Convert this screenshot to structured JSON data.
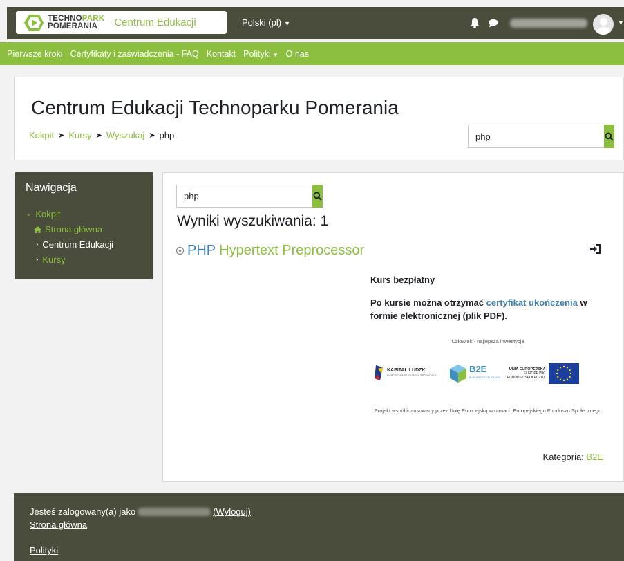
{
  "topbar": {
    "logo_line1": "TECHNO",
    "logo_line1_accent": "PARK",
    "logo_line2": "POMERANIA",
    "brand_name": "Centrum Edukacji",
    "language": "Polski (pl)",
    "icons": {
      "notifications": "bell-icon",
      "messages": "chat-icon",
      "avatar": "user-avatar-icon"
    }
  },
  "menu": {
    "items": [
      "Pierwsze kroki",
      "Certyfikaty i zaświadczenia - FAQ",
      "Kontakt",
      "Polityki",
      "O nas"
    ]
  },
  "header": {
    "title": "Centrum Edukacji Technoparku Pomerania",
    "breadcrumb": [
      "Kokpit",
      "Kursy",
      "Wyszukaj",
      "php"
    ],
    "search_value": "php"
  },
  "navigation": {
    "title": "Nawigacja",
    "items": [
      "Kokpit",
      "Strona główna",
      "Centrum Edukacji",
      "Kursy"
    ]
  },
  "results": {
    "search_value": "php",
    "heading": "Wyniki wyszukiwania: 1",
    "course": {
      "keyword": "PHP",
      "rest": "Hypertext Preprocessor"
    },
    "summary": {
      "free": "Kurs bezpłatny",
      "cert_before": "Po kursie można otrzymać",
      "cert_link": "certyfikat ukończenia",
      "cert_after": "w formie elektronicznej (plik PDF).",
      "motto": "Człowiek - najlepsza inwestycja",
      "funding": "Projekt współfinansowany przez Unię Europejską w ramach Europejskiego Funduszu Społecznego",
      "logo_kl": "KAPITAŁ LUDZKI",
      "logo_kl_sub": "NARODOWA STRATEGIA SPÓJNOŚCI",
      "logo_b2e": "B2E",
      "logo_b2e_sub": "BUSINESS TO EDUCATION",
      "logo_ue_title": "UNIA EUROPEJSKA",
      "logo_ue_line2": "EUROPEJSKI",
      "logo_ue_line3": "FUNDUSZ SPOŁECZNY"
    },
    "category_label": "Kategoria:",
    "category_value": "B2E"
  },
  "footer": {
    "logged_in_as": "Jesteś zalogowany(a) jako",
    "logout": "(Wyloguj)",
    "home": "Strona główna",
    "policies": "Polityki"
  },
  "colors": {
    "dark": "#4a4c3c",
    "accent_green": "#8cbf3f",
    "link_blue": "#3f82b5",
    "background": "#f2f2f2"
  }
}
